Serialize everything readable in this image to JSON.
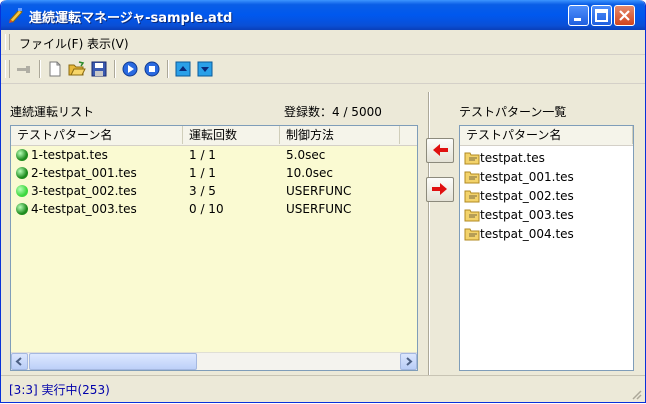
{
  "window": {
    "title": "連続運転マネージャ-sample.atd"
  },
  "menu": {
    "items": [
      "ファイル(F)",
      "表示(V)"
    ]
  },
  "left_panel": {
    "title": "連続運転リスト",
    "count_label": "登録数：4 / 5000",
    "columns": [
      "テストパターン名",
      "運転回数",
      "制御方法"
    ],
    "rows": [
      {
        "name": "1-testpat.tes",
        "count": "1 / 1",
        "method": "5.0sec",
        "dot_color": "#1e8c1e"
      },
      {
        "name": "2-testpat_001.tes",
        "count": "1 / 1",
        "method": "10.0sec",
        "dot_color": "#1e8c1e"
      },
      {
        "name": "3-testpat_002.tes",
        "count": "3 / 5",
        "method": "USERFUNC",
        "dot_color": "#3ed83e"
      },
      {
        "name": "4-testpat_003.tes",
        "count": "0 / 10",
        "method": "USERFUNC",
        "dot_color": "#1e8c1e"
      }
    ]
  },
  "right_panel": {
    "title": "テストパターン一覧",
    "column": "テストパターン名",
    "files": [
      "testpat.tes",
      "testpat_001.tes",
      "testpat_002.tes",
      "testpat_003.tes",
      "testpat_004.tes"
    ]
  },
  "status": {
    "text": "[3:3] 実行中(253)"
  }
}
